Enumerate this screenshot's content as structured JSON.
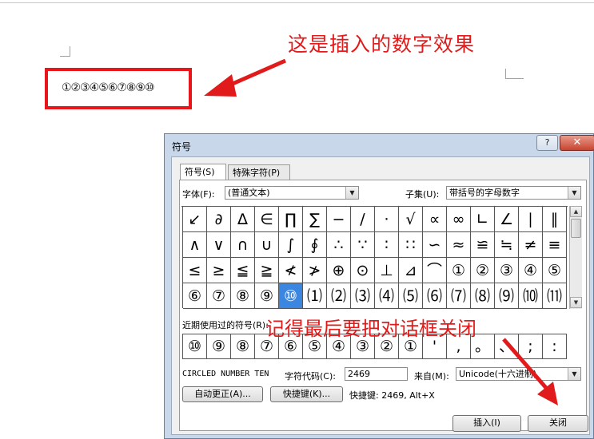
{
  "document": {
    "annotation_top": "这是插入的数字效果",
    "circled_numbers": "①②③④⑤⑥⑦⑧⑨⑩"
  },
  "annotation_bottom": "记得最后要把对话框关闭",
  "dialog": {
    "title": "符号",
    "help_button": "?",
    "close_button": "✕",
    "tabs": [
      {
        "label": "符号(S)",
        "active": true
      },
      {
        "label": "特殊字符(P)",
        "active": false
      }
    ],
    "font_label": "字体(F):",
    "font_value": "(普通文本)",
    "subset_label": "子集(U):",
    "subset_value": "带括号的字母数字",
    "symbol_rows": [
      [
        "↙",
        "∂",
        "∆",
        "∈",
        "∏",
        "∑",
        "−",
        "∕",
        "·",
        "√",
        "∝",
        "∞",
        "∟",
        "∠",
        "∣",
        "∥"
      ],
      [
        "∧",
        "∨",
        "∩",
        "∪",
        "∫",
        "∮",
        "∴",
        "∵",
        "∶",
        "∷",
        "∽",
        "≈",
        "≌",
        "≒",
        "≠",
        "≡"
      ],
      [
        "≤",
        "≥",
        "≦",
        "≧",
        "≮",
        "≯",
        "⊕",
        "⊙",
        "⊥",
        "⊿",
        "⌒",
        "①",
        "②",
        "③",
        "④",
        "⑤"
      ],
      [
        "⑥",
        "⑦",
        "⑧",
        "⑨",
        "⑩",
        "⑴",
        "⑵",
        "⑶",
        "⑷",
        "⑸",
        "⑹",
        "⑺",
        "⑻",
        "⑼",
        "⑽",
        "⑾"
      ]
    ],
    "selected_symbol": "⑩",
    "recent_label": "近期使用过的符号(R):",
    "recent_symbols": [
      "⑩",
      "⑨",
      "⑧",
      "⑦",
      "⑥",
      "⑤",
      "④",
      "③",
      "②",
      "①",
      "'",
      ",",
      "。",
      "、",
      ";",
      ":"
    ],
    "char_name": "CIRCLED NUMBER TEN",
    "char_code_label": "字符代码(C):",
    "char_code_value": "2469",
    "from_label": "来自(M):",
    "from_value": "Unicode(十六进制)",
    "autocorrect_button": "自动更正(A)...",
    "shortcut_button": "快捷键(K)...",
    "shortcut_text": "快捷键: 2469, Alt+X",
    "insert_button": "插入(I)",
    "close_label_button": "关闭"
  },
  "colors": {
    "annotation": "#e11b1b",
    "selection": "#3b86e0"
  }
}
